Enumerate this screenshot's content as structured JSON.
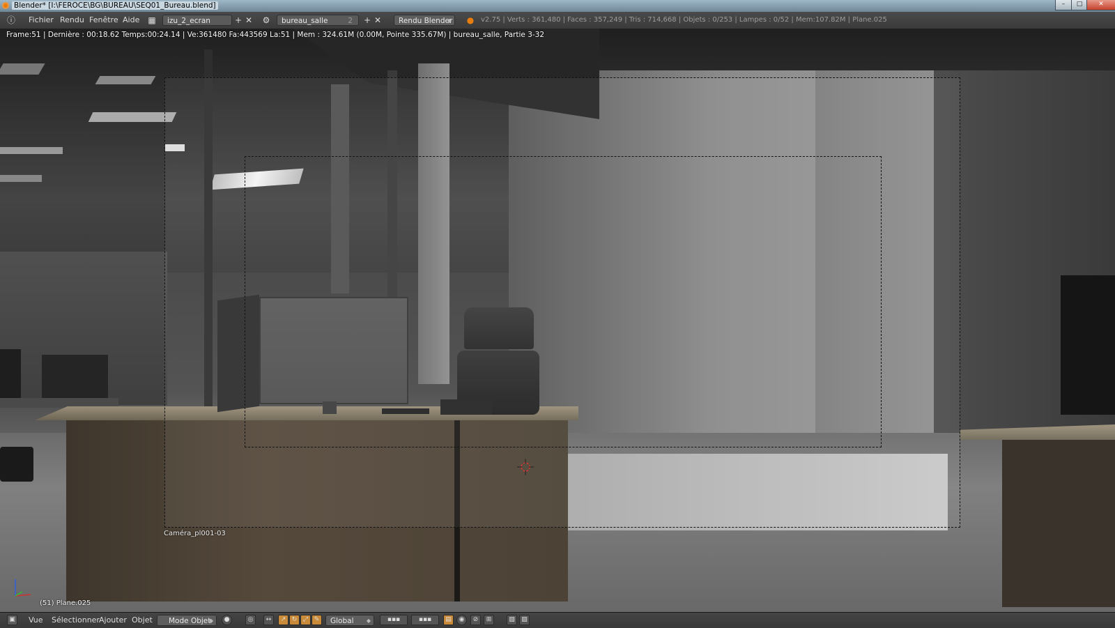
{
  "window": {
    "title": "Blender* [I:\\FEROCE\\BG\\BUREAU\\SEQ01_Bureau.blend]",
    "minimize_label": "–",
    "maximize_label": "□",
    "close_label": "✕"
  },
  "header": {
    "menus": [
      "Fichier",
      "Rendu",
      "Fenêtre",
      "Aide"
    ],
    "screen_layout": "izu_2_ecran",
    "scene_name": "bureau_salle",
    "scene_users": "2",
    "render_engine": "Rendu Blender",
    "stats": "v2.75 | Verts : 361,480 | Faces : 357,249 | Tris : 714,668 | Objets : 0/253 | Lampes : 0/52 | Mem:107.82M | Plane.025"
  },
  "viewport": {
    "render_info": "Frame:51 | Dernière : 00:18.62 Temps:00:24.14 | Ve:361480 Fa:443569 La:51 | Mem : 324.61M (0.00M, Pointe 335.67M) | bureau_salle, Partie 3-32",
    "camera_name": "Caméra_pl001-03",
    "object_info": "(51) Plane.025"
  },
  "footer": {
    "menus": [
      "Vue",
      "Sélectionner",
      "Ajouter",
      "Objet"
    ],
    "mode": "Mode Objet",
    "orientation": "Global"
  },
  "colors": {
    "accent": "#e87d0d",
    "header_bg": "#3e3e3e",
    "tool_active": "#c98b3a"
  },
  "icons": [
    "blender-icon",
    "info-editor-icon",
    "screen-layout-icon",
    "scene-icon",
    "add-icon",
    "close-icon",
    "engine-icon",
    "viewport-shading-icon",
    "pivot-icon",
    "manipulator-icon",
    "translate-icon",
    "rotate-icon",
    "scale-icon",
    "layer-grid-icon",
    "lock-icon",
    "proportional-icon",
    "snap-icon",
    "render-icon"
  ]
}
